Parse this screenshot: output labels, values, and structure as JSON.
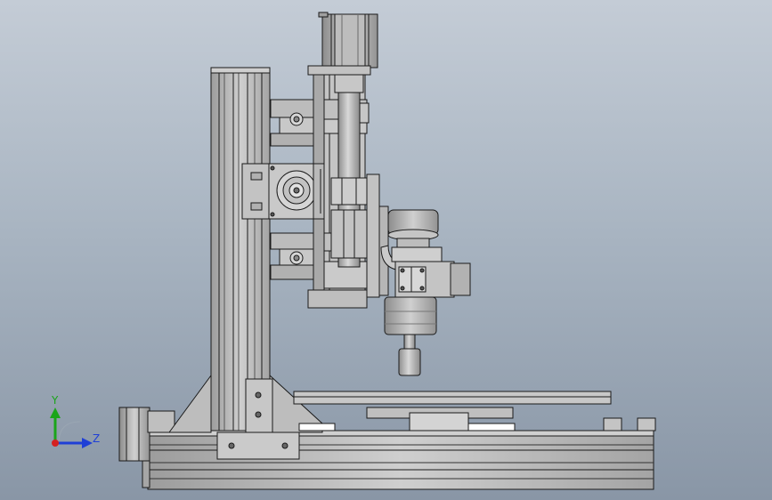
{
  "viewport": {
    "background_top": "#c4ccd6",
    "background_bottom": "#8996a6"
  },
  "triad": {
    "y_label": "Y",
    "z_label": "Z",
    "y_color": "#1aa51a",
    "z_color": "#1f3fd6",
    "origin_color": "#d42020"
  },
  "model": {
    "icon": "cnc-mill-assembly-icon",
    "body_color": "#b9b9b9",
    "edge_color": "#1a1a1a"
  }
}
